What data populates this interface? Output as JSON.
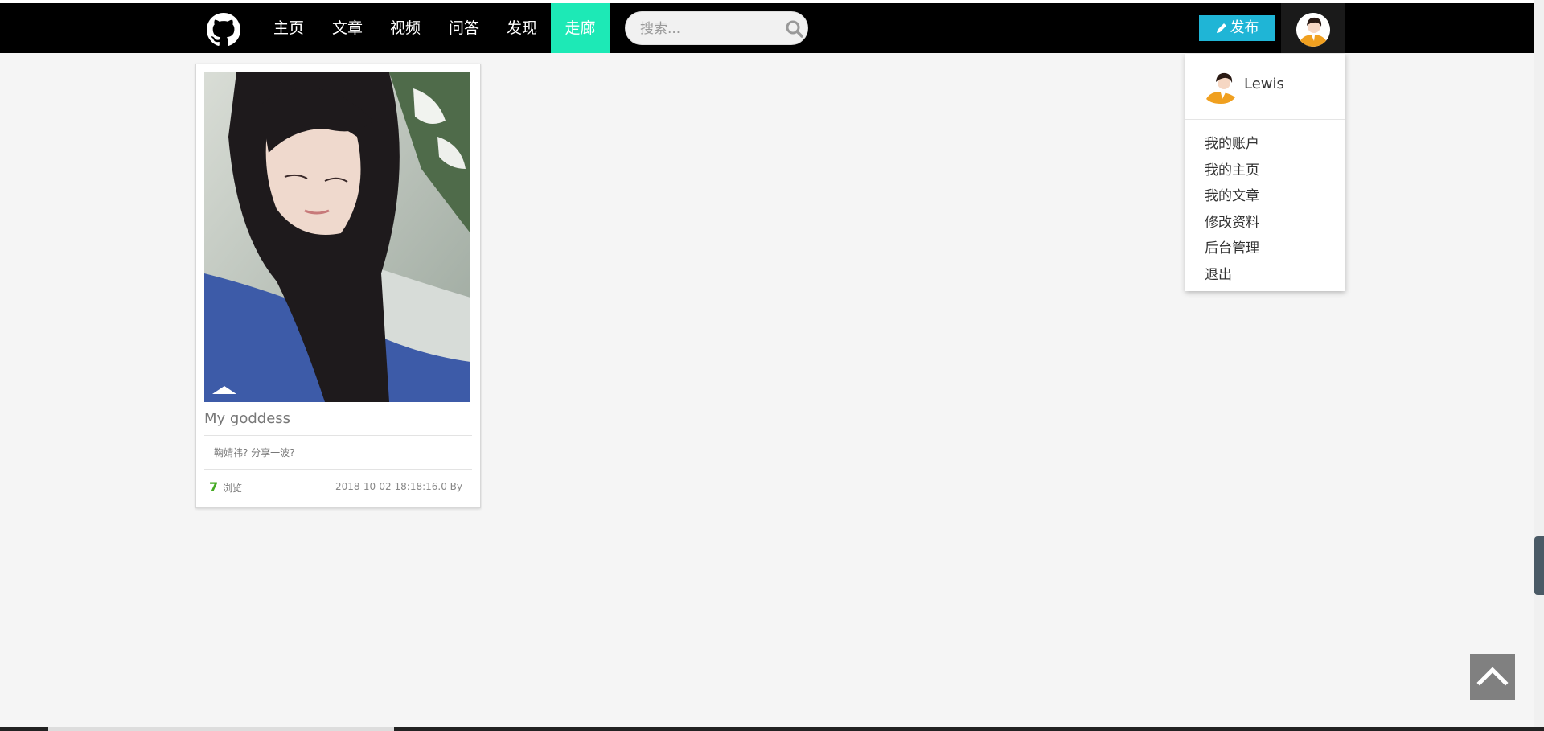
{
  "navbar": {
    "logo_icon": "github-icon",
    "items": [
      {
        "label": "主页",
        "active": false
      },
      {
        "label": "文章",
        "active": false
      },
      {
        "label": "视频",
        "active": false
      },
      {
        "label": "问答",
        "active": false
      },
      {
        "label": "发现",
        "active": false
      },
      {
        "label": "走廊",
        "active": true
      }
    ],
    "active_color": "#1de9b6",
    "search_placeholder": "搜索...",
    "publish_label": "发布",
    "publish_color": "#1fb5d6"
  },
  "card": {
    "title": "My goddess",
    "description": "鞠婧祎? 分享一波?",
    "views_count": "7",
    "views_label": "浏览",
    "date": "2018-10-02 18:18:16.0 By"
  },
  "user_menu": {
    "username": "Lewis",
    "items": [
      "我的账户",
      "我的主页",
      "我的文章",
      "修改资料",
      "后台管理",
      "退出"
    ]
  },
  "back_to_top_icon": "chevron-up-icon"
}
